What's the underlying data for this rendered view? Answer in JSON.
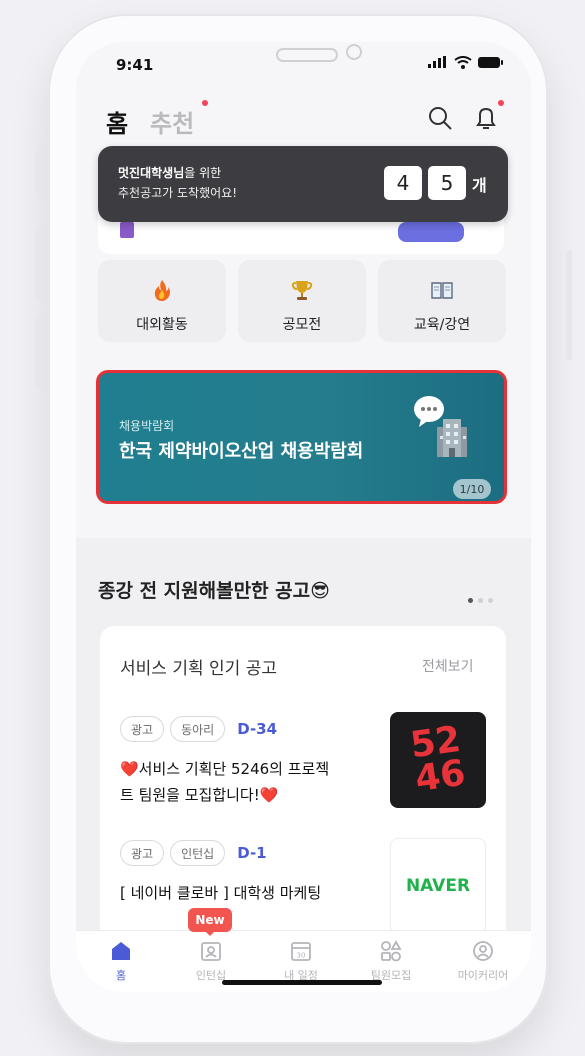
{
  "status": {
    "time": "9:41"
  },
  "header": {
    "tab_home": "홈",
    "tab_recommend": "추천"
  },
  "tooltip": {
    "user": "멋진대학생님",
    "line1_suffix": "을 위한",
    "line2": "추천공고가 도착했어요!",
    "count_digits": [
      "4",
      "5"
    ],
    "count_unit": "개"
  },
  "categories": [
    {
      "label": "대외활동",
      "icon": "fire-icon"
    },
    {
      "label": "공모전",
      "icon": "trophy-icon"
    },
    {
      "label": "교육/강연",
      "icon": "book-icon"
    }
  ],
  "banner": {
    "subtitle": "채용박람회",
    "title": "한국 제약바이오산업 채용박람회",
    "pager": "1/10",
    "icon": "building-chat-icon"
  },
  "section": {
    "title": "종강 전 지원해볼만한 공고😎"
  },
  "list_card": {
    "title": "서비스 기획 인기 공고",
    "see_all": "전체보기",
    "items": [
      {
        "tags": [
          "광고",
          "동아리"
        ],
        "dday": "D-34",
        "title_line1": "❤️서비스 기획단 5246의 프로젝",
        "title_line2": "트 팀원을 모집합니다!❤️",
        "thumb_text_1": "52",
        "thumb_text_2": "46"
      },
      {
        "tags": [
          "광고",
          "인턴십"
        ],
        "dday": "D-1",
        "title_line1": "[ 네이버 클로바 ] 대학생 마케팅",
        "thumb_text": "NAVER"
      }
    ]
  },
  "bottom_nav": {
    "new_badge": "New",
    "items": [
      {
        "label": "홈",
        "active": true
      },
      {
        "label": "인턴십",
        "active": false
      },
      {
        "label": "내 일정",
        "active": false,
        "icon_text": "30"
      },
      {
        "label": "팀원모집",
        "active": false
      },
      {
        "label": "마이커리어",
        "active": false
      }
    ]
  },
  "colors": {
    "accent": "#4b5bd6",
    "alert": "#f2455b",
    "banner": "#1f7e90",
    "highlight_border": "#e53238",
    "naver_green": "#22b14c"
  }
}
